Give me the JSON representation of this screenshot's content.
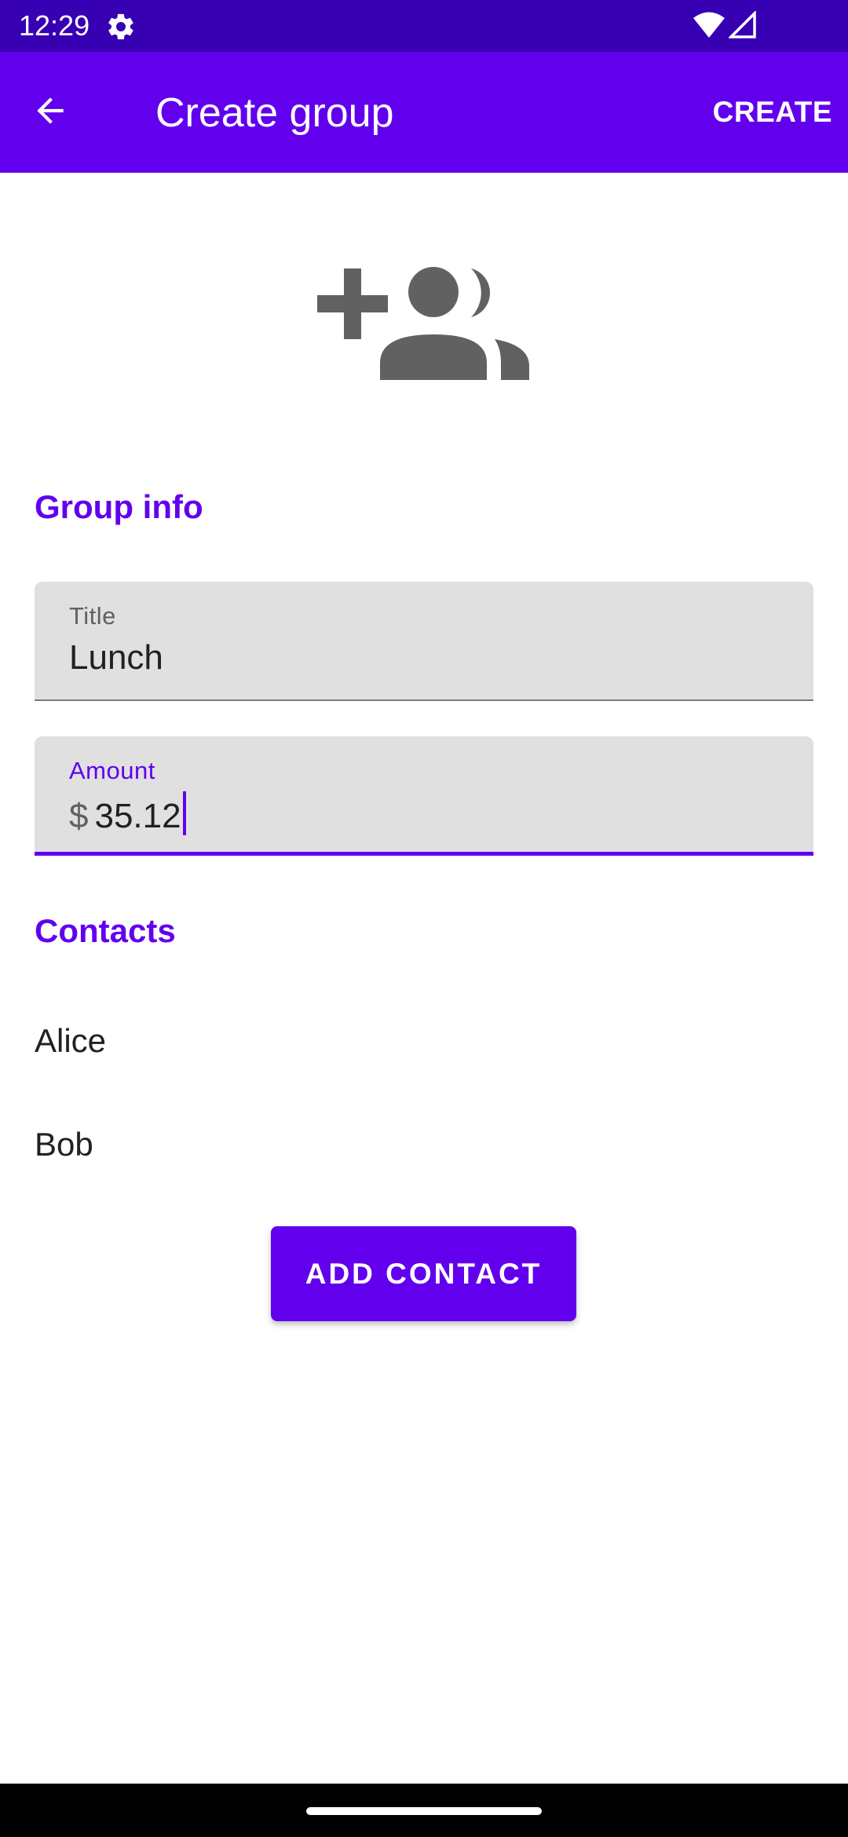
{
  "status_bar": {
    "time": "12:29",
    "icons": [
      "settings-icon",
      "wifi-icon",
      "signal-icon"
    ]
  },
  "app_bar": {
    "title": "Create group",
    "action_label": "CREATE",
    "back_icon": "arrow-back-icon",
    "background_color": "#6200ee"
  },
  "hero": {
    "icon": "group-add-icon"
  },
  "group_info": {
    "header": "Group info",
    "title_field": {
      "label": "Title",
      "value": "Lunch"
    },
    "amount_field": {
      "label": "Amount",
      "prefix": "$",
      "value": "35.12",
      "focused": true
    }
  },
  "contacts": {
    "header": "Contacts",
    "items": [
      {
        "name": "Alice"
      },
      {
        "name": "Bob"
      }
    ],
    "add_button_label": "ADD CONTACT"
  },
  "colors": {
    "accent": "#6200ee",
    "status_bar": "#3700b3"
  }
}
